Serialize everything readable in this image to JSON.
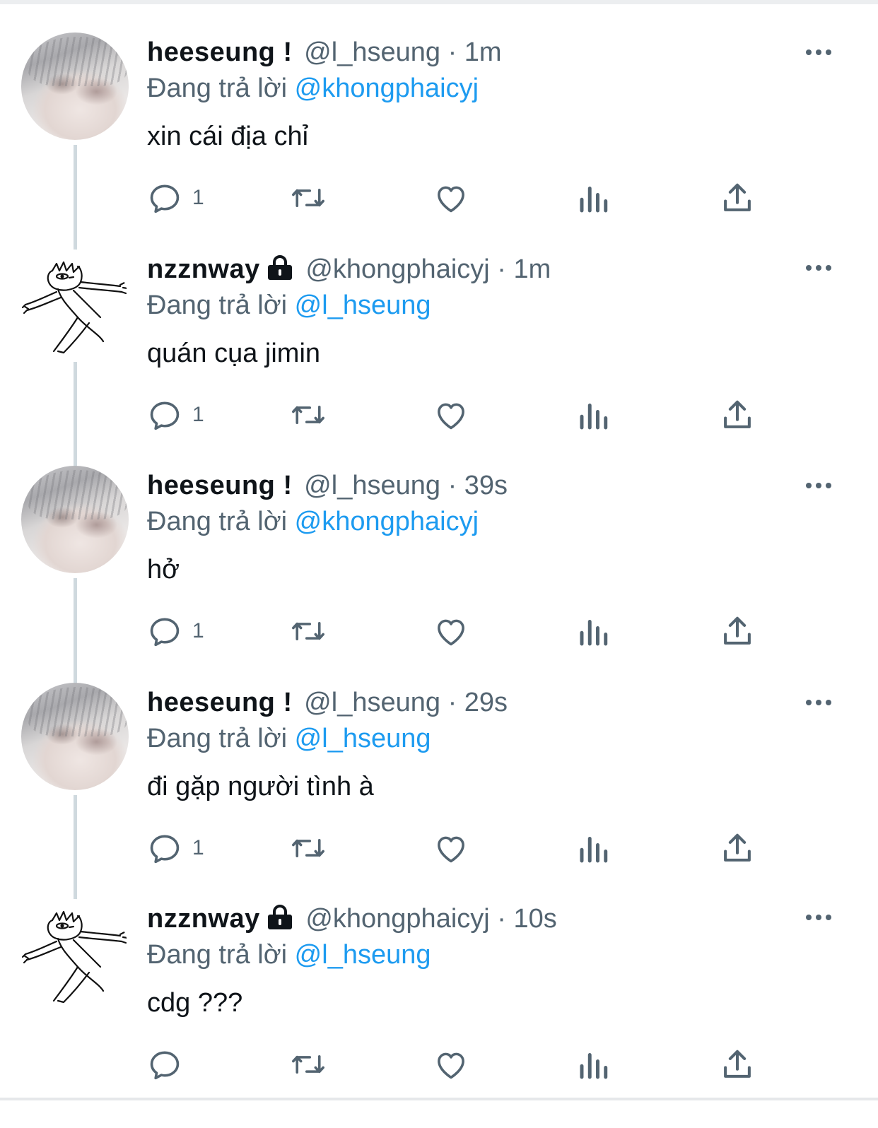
{
  "tweets": [
    {
      "name": "heeseung !",
      "locked": false,
      "avatar": "heeseung-photo",
      "handle": "@l_hseung",
      "separator": "·",
      "time": "1m",
      "replying_prefix": "Đang trả lời",
      "replying_to": "@khongphaicyj",
      "text": "xin cái địa chỉ",
      "reply_count": "1"
    },
    {
      "name": "nzznway",
      "locked": true,
      "avatar": "nzznway-drawing",
      "handle": "@khongphaicyj",
      "separator": "·",
      "time": "1m",
      "replying_prefix": "Đang trả lời",
      "replying_to": "@l_hseung",
      "text": "quán cụa jimin",
      "reply_count": "1"
    },
    {
      "name": "heeseung !",
      "locked": false,
      "avatar": "heeseung-photo",
      "handle": "@l_hseung",
      "separator": "·",
      "time": "39s",
      "replying_prefix": "Đang trả lời",
      "replying_to": "@khongphaicyj",
      "text": "hở",
      "reply_count": "1"
    },
    {
      "name": "heeseung !",
      "locked": false,
      "avatar": "heeseung-photo",
      "handle": "@l_hseung",
      "separator": "·",
      "time": "29s",
      "replying_prefix": "Đang trả lời",
      "replying_to": "@l_hseung",
      "text": "đi gặp người tình à",
      "reply_count": "1"
    },
    {
      "name": "nzznway",
      "locked": true,
      "avatar": "nzznway-drawing",
      "handle": "@khongphaicyj",
      "separator": "·",
      "time": "10s",
      "replying_prefix": "Đang trả lời",
      "replying_to": "@l_hseung",
      "text": "cdg ???",
      "reply_count": ""
    }
  ],
  "icons": {
    "reply": "reply-icon",
    "retweet": "retweet-icon",
    "like": "like-icon",
    "views": "views-icon",
    "share": "share-icon",
    "more": "more-icon",
    "lock": "lock-icon"
  },
  "colors": {
    "text": "#0f1419",
    "secondary": "#536471",
    "mention": "#1d9bf0",
    "thread_line": "#cfd9de",
    "icon": "#536471"
  }
}
